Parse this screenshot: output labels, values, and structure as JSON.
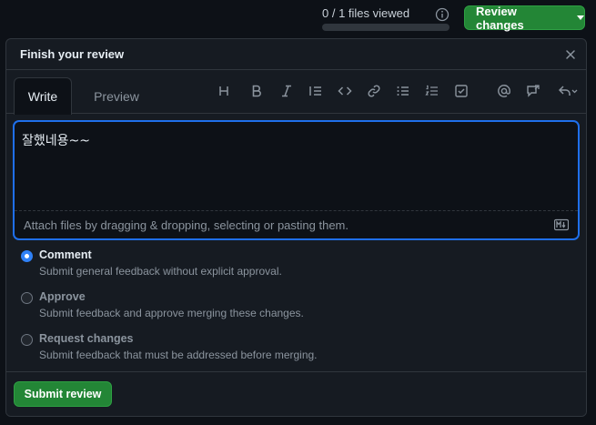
{
  "topbar": {
    "files_viewed": "0 / 1 files viewed",
    "review_button": "Review changes"
  },
  "review": {
    "title": "Finish your review",
    "tabs": [
      {
        "label": "Write",
        "active": true
      },
      {
        "label": "Preview",
        "active": false
      }
    ],
    "toolbar_icons": [
      "heading-icon",
      "bold-icon",
      "italic-icon",
      "quote-icon",
      "code-icon",
      "link-icon",
      "bulleted-list-icon",
      "numbered-list-icon",
      "task-list-icon",
      "mention-icon",
      "cross-reference-icon",
      "reply-icon"
    ],
    "comment_value": "잘했네용~~",
    "attach_text": "Attach files by dragging & dropping, selecting or pasting them.",
    "options": [
      {
        "title": "Comment",
        "description": "Submit general feedback without explicit approval.",
        "checked": true
      },
      {
        "title": "Approve",
        "description": "Submit feedback and approve merging these changes.",
        "checked": false
      },
      {
        "title": "Request changes",
        "description": "Submit feedback that must be addressed before merging.",
        "checked": false
      }
    ],
    "submit_label": "Submit review"
  },
  "colors": {
    "background": "#0d1117",
    "panel": "#161b22",
    "border": "#30363d",
    "accent_green": "#238636",
    "focus_blue": "#1f6feb",
    "muted_text": "#8b949e"
  }
}
